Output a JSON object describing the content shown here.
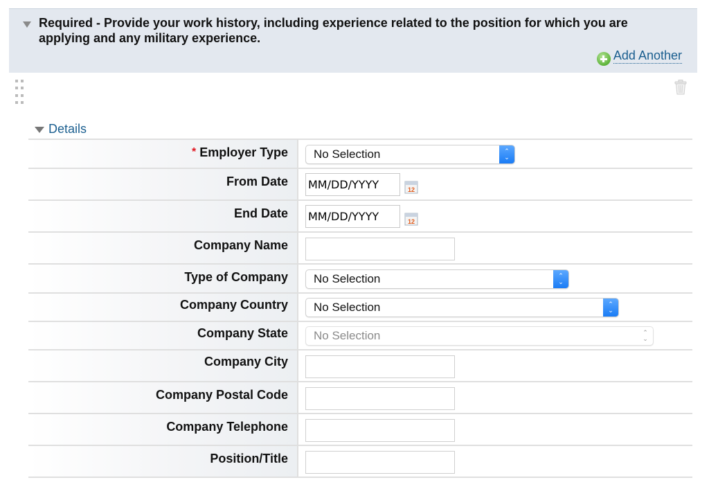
{
  "section": {
    "title": "Required - Provide your work history, including experience related to the position for which you are applying and any military experience.",
    "add_another_label": "Add Another",
    "details_label": "Details"
  },
  "colors": {
    "header_bg": "#e3e8ef",
    "link": "#1a5e8f",
    "required_marker": "#e0141e",
    "select_arrow": "#1a7cf5"
  },
  "fields": {
    "employer_type": {
      "label": "Employer Type",
      "required": "*",
      "value": "No Selection"
    },
    "from_date": {
      "label": "From Date",
      "value": "MM/DD/YYYY"
    },
    "end_date": {
      "label": "End Date",
      "value": "MM/DD/YYYY"
    },
    "company_name": {
      "label": "Company Name",
      "value": ""
    },
    "type_of_company": {
      "label": "Type of Company",
      "value": "No Selection"
    },
    "company_country": {
      "label": "Company Country",
      "value": "No Selection"
    },
    "company_state": {
      "label": "Company State",
      "value": "No Selection",
      "disabled": true
    },
    "company_city": {
      "label": "Company City",
      "value": ""
    },
    "company_postal_code": {
      "label": "Company Postal Code",
      "value": ""
    },
    "company_telephone": {
      "label": "Company Telephone",
      "value": ""
    },
    "position_title": {
      "label": "Position/Title",
      "value": ""
    }
  }
}
